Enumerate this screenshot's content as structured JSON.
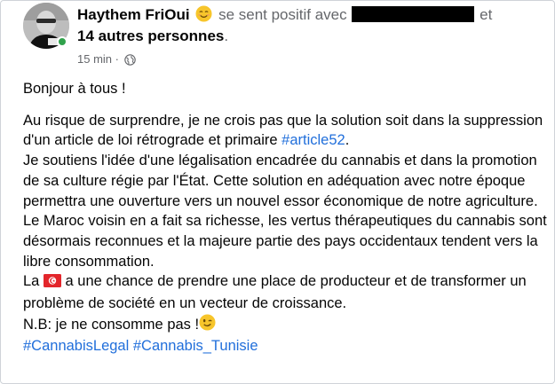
{
  "post": {
    "author": "Haythem FriOui",
    "feeling_text": "se sent positif avec",
    "and_text": "et",
    "others_text": "14 autres personnes",
    "others_suffix": ".",
    "time": "15 min",
    "dot": "·",
    "icons": {
      "feeling": "smiling-face-emoji",
      "privacy": "globe-icon",
      "flag": "tunisia-flag-emoji",
      "wink": "winking-face-emoji"
    },
    "colors": {
      "hashtag": "#216fdb",
      "secondary_text": "#65676b",
      "online": "#31a24c"
    }
  },
  "body": {
    "greeting": "Bonjour à tous !",
    "p1": "Au risque de surprendre, je ne crois pas que la solution soit dans la suppression d'un article de loi rétrograde et primaire",
    "p1_tag": "#article52",
    "p1_end": ".",
    "p2": "Je soutiens l'idée d'une légalisation encadrée du cannabis et dans la promotion de sa culture régie par l'État. Cette solution en adéquation avec notre époque permettra une ouverture vers un nouvel essor économique de notre agriculture.",
    "p3": "Le Maroc voisin en a fait sa richesse, les vertus thérapeutiques du cannabis sont désormais reconnues et la majeure partie des pays occidentaux tendent vers la libre consommation.",
    "p4_start": "La",
    "p4_rest": "a une chance de prendre une place de producteur et de transformer un problème de société en un vecteur de croissance.",
    "nb": "N.B: je ne consomme pas !",
    "tag1": "#CannabisLegal",
    "tag2": "#Cannabis_Tunisie"
  }
}
